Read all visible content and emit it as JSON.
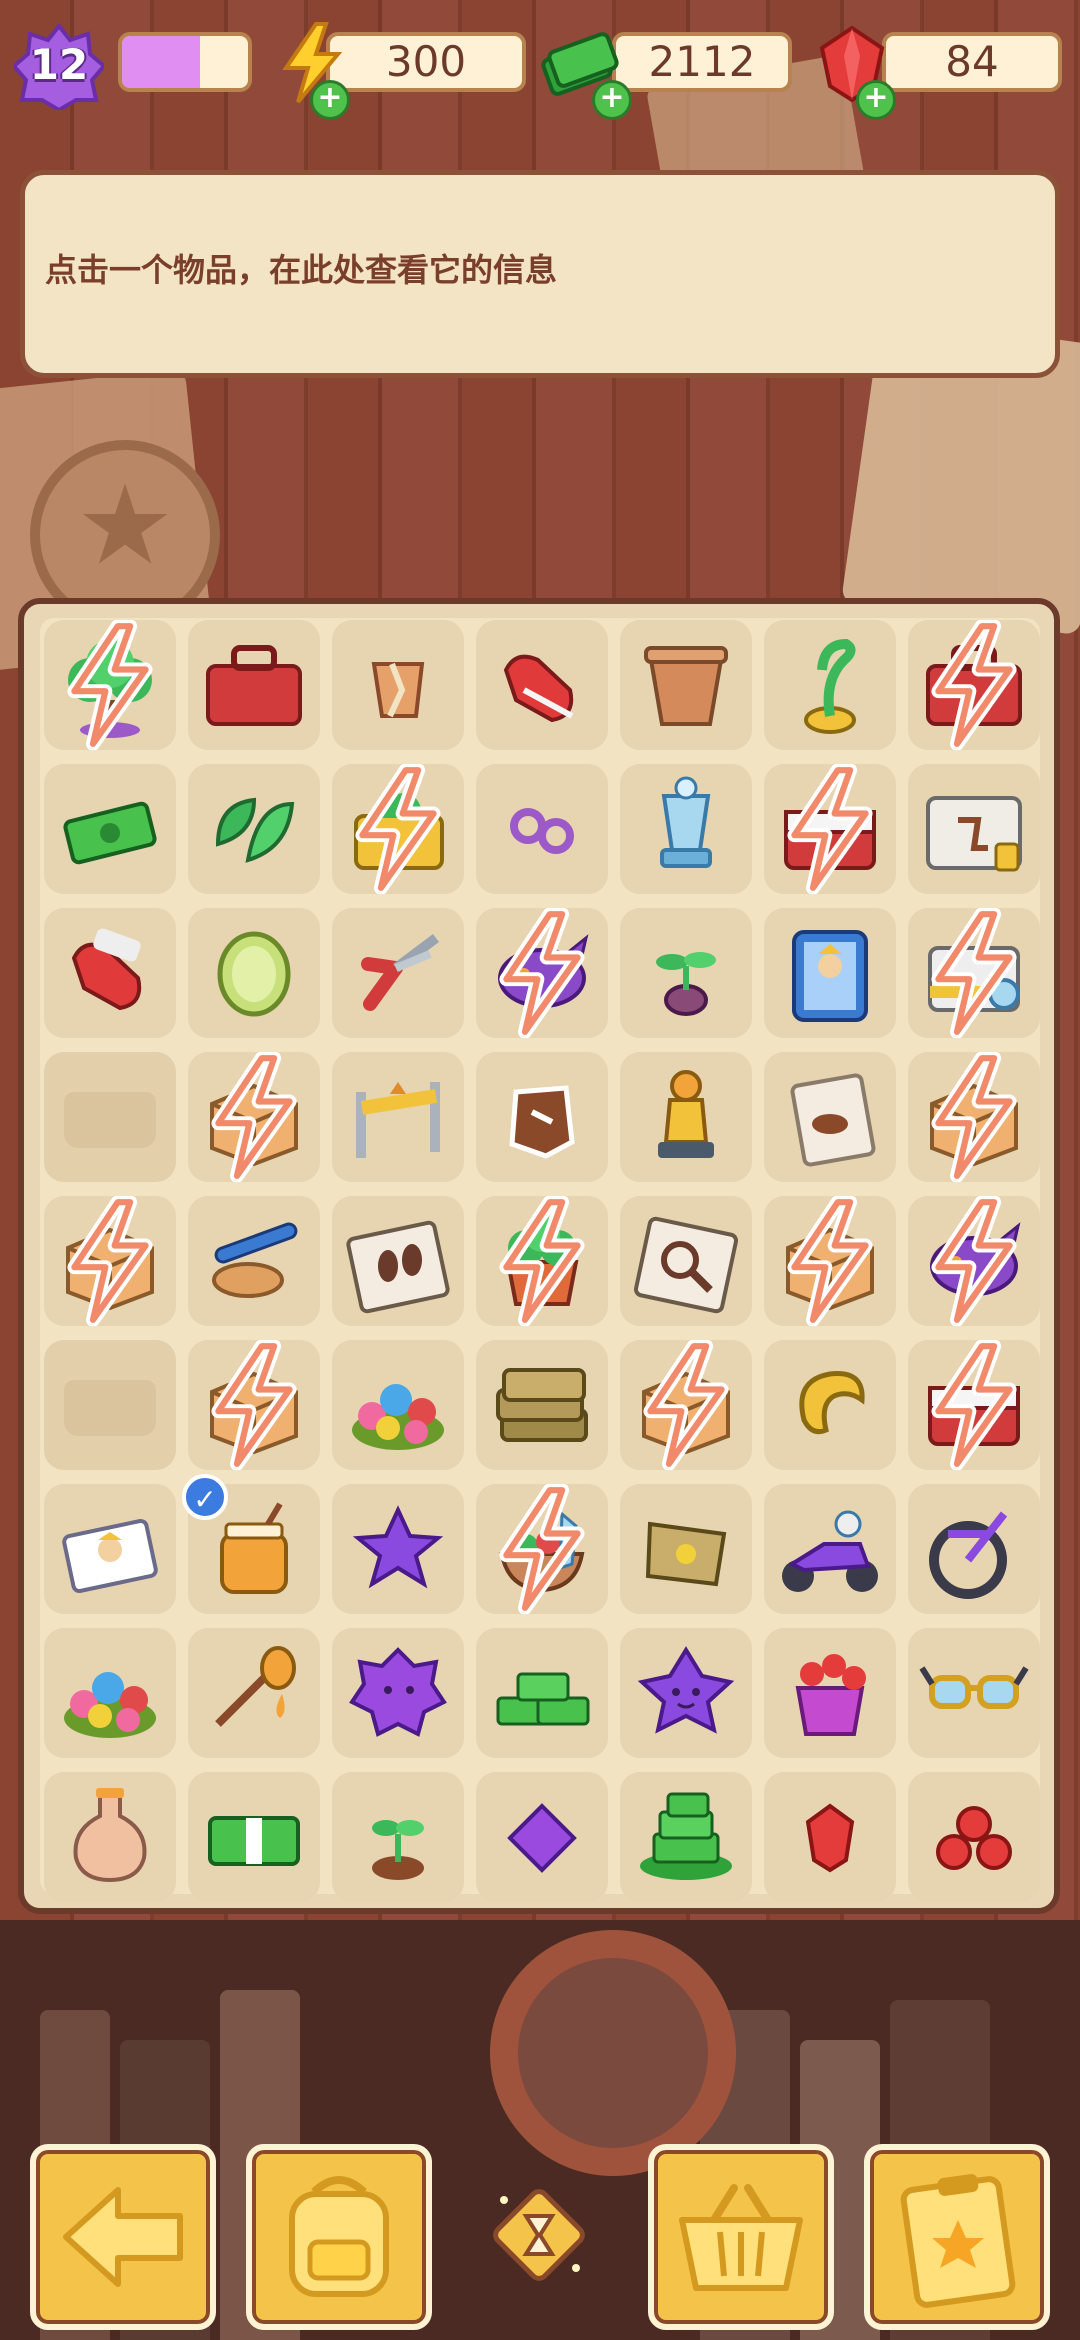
{
  "hud": {
    "level": "12",
    "level_progress": 0.62,
    "energy": "300",
    "cash": "2112",
    "gems": "84"
  },
  "info": {
    "hint": "点击一个物品，在此处查看它的信息"
  },
  "board": {
    "rows": [
      [
        "bonsai-tree-generator",
        "red-toolbox",
        "broken-pottery",
        "red-gloves",
        "clay-pot",
        "green-sprout",
        "red-toolbox-generator"
      ],
      [
        "cash-bill",
        "green-leaves",
        "yellow-plant-box-generator",
        "purple-beads",
        "glass-trophy",
        "red-chest-generator",
        "crime-scene-board"
      ],
      [
        "red-glove",
        "cucumber-slice",
        "red-pruning-shears",
        "purple-dragon-generator",
        "seedling-bulb",
        "photo-frame",
        "evidence-box-generator"
      ],
      [
        "empty",
        "cardboard-box-generator",
        "warning-barrier",
        "cookie-footprint",
        "pawn-figure",
        "evidence-bag",
        "cardboard-box-generator"
      ],
      [
        "cardboard-box-generator",
        "rolling-pin-pastry",
        "footprint-evidence-bag",
        "potted-plant-generator",
        "magnifier-evidence-bag",
        "cardboard-box-generator",
        "purple-dragon-generator"
      ],
      [
        "empty",
        "cardboard-box-generator",
        "flower-bouquet",
        "seed-bag-stack",
        "cardboard-box-generator",
        "yellow-bean",
        "red-chest-generator"
      ],
      [
        "character-card",
        "honey-jar",
        "purple-star",
        "salad-bowl-generator",
        "seed-bag",
        "purple-scooter",
        "purple-bicycle"
      ],
      [
        "flower-bouquet",
        "honey-dipper",
        "purple-splat",
        "cash-stack",
        "purple-star-smile",
        "gem-bucket",
        "yellow-sunglasses"
      ],
      [
        "potion-bottle",
        "cash-bundle",
        "seedling-sprout",
        "purple-gem",
        "cash-pile",
        "red-gem",
        "red-gem-cluster"
      ]
    ]
  },
  "bottom": [
    "back",
    "backpack",
    "timer",
    "basket",
    "clipboard"
  ]
}
